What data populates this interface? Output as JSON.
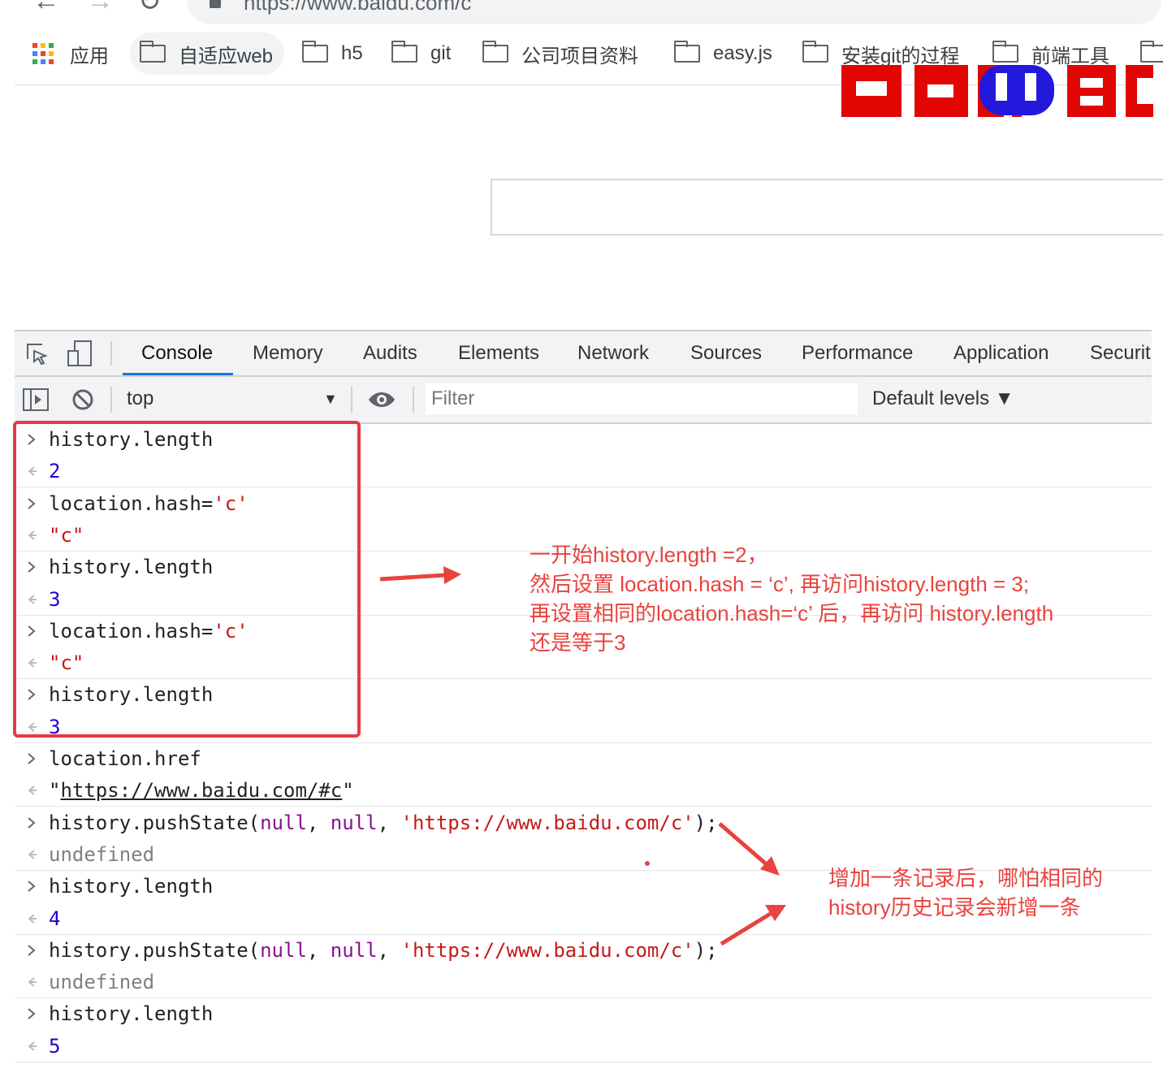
{
  "browser": {
    "url": "https://www.baidu.com/c",
    "bookmarks": [
      {
        "label": "应用",
        "type": "apps"
      },
      {
        "label": "自适应web",
        "type": "folder"
      },
      {
        "label": "h5",
        "type": "folder"
      },
      {
        "label": "git",
        "type": "folder"
      },
      {
        "label": "公司项目资料",
        "type": "folder"
      },
      {
        "label": "easy.js",
        "type": "folder"
      },
      {
        "label": "安装git的过程",
        "type": "folder"
      },
      {
        "label": "前端工具",
        "type": "folder"
      }
    ]
  },
  "devtools": {
    "tabs": [
      "Console",
      "Memory",
      "Audits",
      "Elements",
      "Network",
      "Sources",
      "Performance",
      "Application",
      "Securit"
    ],
    "active_tab": "Console",
    "toolbar": {
      "context": "top",
      "filter_placeholder": "Filter",
      "levels": "Default levels ▼"
    },
    "console": [
      {
        "kind": "input",
        "tokens": [
          {
            "t": "history.length",
            "c": "black"
          }
        ]
      },
      {
        "kind": "output",
        "tokens": [
          {
            "t": "2",
            "c": "num"
          }
        ]
      },
      {
        "kind": "input",
        "tokens": [
          {
            "t": "location.hash=",
            "c": "black"
          },
          {
            "t": "'c'",
            "c": "str"
          }
        ]
      },
      {
        "kind": "output",
        "tokens": [
          {
            "t": "\"c\"",
            "c": "str"
          }
        ]
      },
      {
        "kind": "input",
        "tokens": [
          {
            "t": "history.length",
            "c": "black"
          }
        ]
      },
      {
        "kind": "output",
        "tokens": [
          {
            "t": "3",
            "c": "num"
          }
        ]
      },
      {
        "kind": "input",
        "tokens": [
          {
            "t": "location.hash=",
            "c": "black"
          },
          {
            "t": "'c'",
            "c": "str"
          }
        ]
      },
      {
        "kind": "output",
        "tokens": [
          {
            "t": "\"c\"",
            "c": "str"
          }
        ]
      },
      {
        "kind": "input",
        "tokens": [
          {
            "t": "history.length",
            "c": "black"
          }
        ]
      },
      {
        "kind": "output",
        "tokens": [
          {
            "t": "3",
            "c": "num"
          }
        ]
      },
      {
        "kind": "input",
        "tokens": [
          {
            "t": "location.href",
            "c": "black"
          }
        ]
      },
      {
        "kind": "output",
        "tokens": [
          {
            "t": "\"",
            "c": "black"
          },
          {
            "t": "https://www.baidu.com/#c",
            "c": "link"
          },
          {
            "t": "\"",
            "c": "black"
          }
        ]
      },
      {
        "kind": "input",
        "tokens": [
          {
            "t": "history.pushState(",
            "c": "black"
          },
          {
            "t": "null",
            "c": "kw"
          },
          {
            "t": ", ",
            "c": "black"
          },
          {
            "t": "null",
            "c": "kw"
          },
          {
            "t": ", ",
            "c": "black"
          },
          {
            "t": "'https://www.baidu.com/c'",
            "c": "str"
          },
          {
            "t": ");",
            "c": "black"
          }
        ]
      },
      {
        "kind": "output",
        "tokens": [
          {
            "t": "undefined",
            "c": "undef"
          }
        ]
      },
      {
        "kind": "input",
        "tokens": [
          {
            "t": "history.length",
            "c": "black"
          }
        ]
      },
      {
        "kind": "output",
        "tokens": [
          {
            "t": "4",
            "c": "num"
          }
        ]
      },
      {
        "kind": "input",
        "tokens": [
          {
            "t": "history.pushState(",
            "c": "black"
          },
          {
            "t": "null",
            "c": "kw"
          },
          {
            "t": ", ",
            "c": "black"
          },
          {
            "t": "null",
            "c": "kw"
          },
          {
            "t": ", ",
            "c": "black"
          },
          {
            "t": "'https://www.baidu.com/c'",
            "c": "str"
          },
          {
            "t": ");",
            "c": "black"
          }
        ]
      },
      {
        "kind": "output",
        "tokens": [
          {
            "t": "undefined",
            "c": "undef"
          }
        ]
      },
      {
        "kind": "input",
        "tokens": [
          {
            "t": "history.length",
            "c": "black"
          }
        ]
      },
      {
        "kind": "output",
        "tokens": [
          {
            "t": "5",
            "c": "num"
          }
        ]
      }
    ]
  },
  "annotations": {
    "note1": [
      "一开始history.length =2，",
      "然后设置 location.hash = ‘c’, 再访问history.length = 3;",
      "再设置相同的location.hash=‘c’ 后，再访问 history.length",
      "还是等于3"
    ],
    "note2": [
      "增加一条记录后，哪怕相同的",
      "history历史记录会新增一条"
    ],
    "color": "#e8433e"
  },
  "colors": {
    "baidu_red": "#e10602",
    "baidu_blue": "#2319dc",
    "accent": "#1a73e8"
  }
}
